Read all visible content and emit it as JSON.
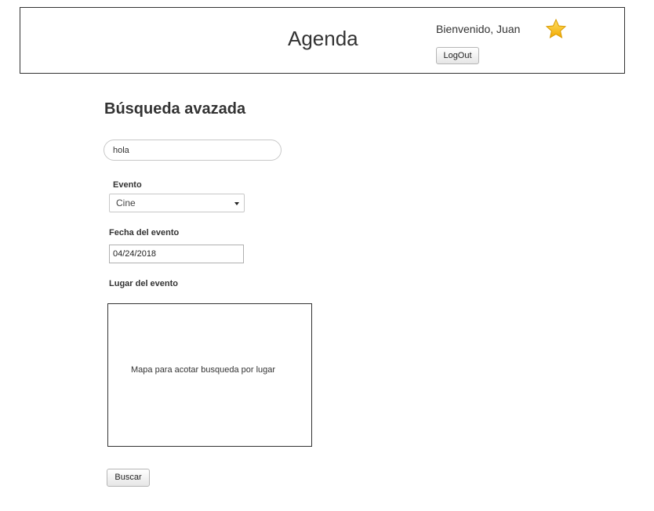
{
  "header": {
    "app_title": "Agenda",
    "welcome": "Bienvenido, Juan",
    "logout_label": "LogOut",
    "star_icon": "star-icon",
    "star_color": "#f5c518"
  },
  "main": {
    "title": "Búsqueda avazada",
    "search": {
      "value": "hola",
      "placeholder": ""
    },
    "evento": {
      "label": "Evento",
      "selected": "Cine"
    },
    "fecha": {
      "label": "Fecha del evento",
      "value": "04/24/2018"
    },
    "lugar": {
      "label": "Lugar del evento",
      "map_text": "Mapa para acotar busqueda por lugar"
    },
    "buscar_label": "Buscar"
  }
}
